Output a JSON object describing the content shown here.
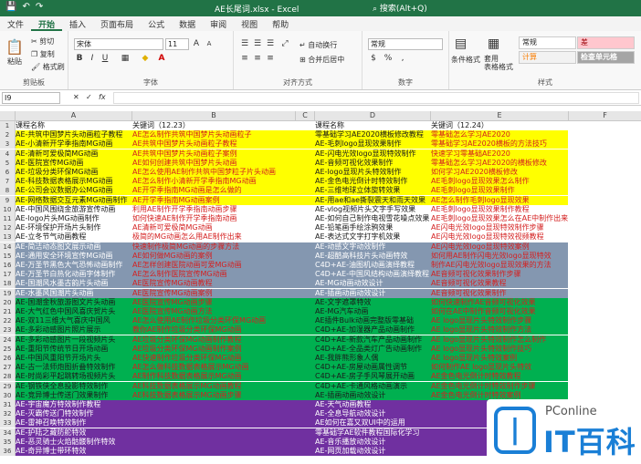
{
  "window": {
    "title": "AE长尾词.xlsx  -  Excel",
    "search": "搜索(Alt+Q)"
  },
  "tabs": [
    "文件",
    "开始",
    "插入",
    "页面布局",
    "公式",
    "数据",
    "审阅",
    "视图",
    "帮助"
  ],
  "ribbon": {
    "clipboard": {
      "label": "剪贴板",
      "paste": "粘贴",
      "cut": "剪切",
      "copy": "复制",
      "painter": "格式刷"
    },
    "font": {
      "label": "字体",
      "name": "宋体",
      "size": "11"
    },
    "align": {
      "label": "对齐方式",
      "wrap": "自动换行",
      "merge": "合并后居中"
    },
    "number": {
      "label": "数字",
      "format": "常规"
    },
    "styles": {
      "label": "样式",
      "cond": "条件格式",
      "table": "套用\n表格格式",
      "normal": "常规",
      "bad": "差",
      "calc": "计算",
      "check": "检查单元格"
    }
  },
  "formula": {
    "name": "I9",
    "fx": "fx"
  },
  "columns": [
    "A",
    "B",
    "C",
    "D",
    "E",
    "F"
  ],
  "colors": {
    "yellow": "#ffff00",
    "white": "#ffffff",
    "slate": "#8497b0",
    "green": "#00b050",
    "purple": "#7030a0",
    "excel": "#217346"
  },
  "rows": [
    {
      "n": "1",
      "bg": "white",
      "a": "课程名称",
      "b": "关键词（12.23）",
      "d": "课程名称",
      "e": "关键词（12.24）",
      "ac": "blk",
      "bc": "blk"
    },
    {
      "n": "2",
      "bg": "yellow",
      "a": "AE-共筑中国梦片头动画粒子教程",
      "b": "AE怎么制作共筑中国梦片头动画粒子",
      "d": "零基础学习AE2020横板修改教程",
      "e": "零基础怎么学习AE2020",
      "ac": "blk",
      "bc": "red"
    },
    {
      "n": "3",
      "bg": "yellow",
      "a": "AE-小清新开学季指南MG动画",
      "b": "AE共筑中国梦片头动画粒子教程",
      "d": "AE-毛刺logo显现效果制作",
      "e": "零基础学习AE2020横板的方法技巧",
      "ac": "blk",
      "bc": "red"
    },
    {
      "n": "4",
      "bg": "yellow",
      "a": "AE-清新可爱极简MG动画",
      "b": "AE共筑中国梦片头动画粒子案例",
      "d": "AE-闪电光效logo显现特效制作",
      "e": "快速学习零基础AE2020",
      "ac": "blk",
      "bc": "red"
    },
    {
      "n": "5",
      "bg": "yellow",
      "a": "AE-医院宣传MG动画",
      "b": "AE如何创建共筑中国梦片头动画",
      "d": "AE-音频可视化效果制作",
      "e": "零基础怎么学习AE2020的横板修改",
      "ac": "blk",
      "bc": "red"
    },
    {
      "n": "6",
      "bg": "yellow",
      "a": "AE-垃圾分类环保MG动画",
      "b": "AE怎么使用AE制作共筑中国梦粒子片头动画",
      "d": "AE-logo显现片头特效制作",
      "e": "如何学习AE2020横板修改",
      "ac": "blk",
      "bc": "red"
    },
    {
      "n": "7",
      "bg": "yellow",
      "a": "AE-科技数据表格展示MG动画",
      "b": "AE怎么制作小清新开学季指南MG动画",
      "d": "AE-金色电光倒计时特效制作",
      "e": "AE毛刺logo显现效果怎么制作",
      "ac": "blk",
      "bc": "red"
    },
    {
      "n": "8",
      "bg": "yellow",
      "a": "AE-公司会议数据办公MG动画",
      "b": "AE开学季指南MG动画是怎么做的",
      "d": "AE-三维地球立体旋转效果",
      "e": "AE毛刺logo显现效果制作",
      "ac": "blk",
      "bc": "red"
    },
    {
      "n": "9",
      "bg": "yellow",
      "a": "AE-网络数据交互元素MG动画制作",
      "b": "AE开学季指南MG动画案例",
      "d": "AE-用ae和ae撕裂震天和雨天效果",
      "e": "AE怎么制作毛刺logo显现效果",
      "ac": "blk",
      "bc": "red"
    },
    {
      "n": "10",
      "bg": "white",
      "a": "AE-中国风围绕金旅游宣传动画",
      "b": "利用AE制作开学季指南动画步骤",
      "d": "AE-vlog视频片头文字手写效果",
      "e": "AE毛刺logo显现效果制作教程",
      "ac": "blk",
      "bc": "red"
    },
    {
      "n": "11",
      "bg": "white",
      "a": "AE-logo片头MG动画制作",
      "b": "如何快速AE制作开学季指南动画",
      "d": "AE-如何自己制作电视雪花噪点效果",
      "e": "AE毛刺logo显现效果怎么在AE中制作出来",
      "ac": "blk",
      "bc": "red"
    },
    {
      "n": "12",
      "bg": "white",
      "a": "AE-环境保护开场片头制作",
      "b": "AE清新可爱极简MG动画",
      "d": "AE-铅笔画手绘涂鸦效果",
      "e": "AE闪电光效logo显现特效制作步骤",
      "ac": "blk",
      "bc": "red"
    },
    {
      "n": "13",
      "bg": "white",
      "a": "AE-立冬节气动画教程",
      "b": "极简的MG动画怎么用AE制作出来",
      "d": "AE-表达式文字打字机效果",
      "e": "AE闪电光效logo显现特效视频教程",
      "ac": "blk",
      "bc": "red"
    },
    {
      "n": "14",
      "bg": "slate",
      "a": "AE-简洁动态图文展示动画",
      "b": "快速制作极简MG动画的步骤方法",
      "d": "AE-动感文字动效制作",
      "e": "AE闪电光效logo显现特效案例",
      "ac": "blk",
      "bc": "red"
    },
    {
      "n": "15",
      "bg": "slate",
      "a": "AE-通用安全环境宣传MG动画",
      "b": "AE如何做MG动画的案例",
      "d": "AE-超酷高科技片头动画特效",
      "e": "如何用AE制作闪电光效logo显现特效",
      "ac": "blk",
      "bc": "red"
    },
    {
      "n": "16",
      "bg": "slate",
      "a": "AE-万圣节黑色大气恐怖动画制作",
      "b": "AE怎样创建医院动画可爱MG动画",
      "d": "C4D+AE-油图机动画演绎教程",
      "e": "制作AE闪电光效logo显现效果的方法",
      "ac": "blk",
      "bc": "red"
    },
    {
      "n": "17",
      "bg": "slate",
      "a": "AE-万圣节白热化动画字体制作",
      "b": "AE怎么制作医院宣传MG动画",
      "d": "C4D+AE-中国风结构动画演绎教程",
      "e": "AE音频可视化效果制作步骤",
      "ac": "blk",
      "bc": "red"
    },
    {
      "n": "18",
      "bg": "slate",
      "a": "AE-国潮风水墨古韵片头动画",
      "b": "AE医院宣传MG动画教程",
      "d": "AE-MG动画动效设计",
      "e": "AE音频可视化效果教程",
      "ac": "blk",
      "bc": "red"
    },
    {
      "n": "19",
      "bg": "slate",
      "a": "AE-水墨风国潮片头动画",
      "b": "AE医院宣传MG动画案例",
      "d": "AE-插画动画动效设计",
      "e": "AE音频可视化效果制作",
      "ac": "blk",
      "bc": "red"
    },
    {
      "n": "20",
      "bg": "green",
      "a": "AE-国潮金秋旅游图文片头动画",
      "b": "AE医院宣传MG动画步骤",
      "d": "AE-文字遮罩特效",
      "e": "如何快速制作AE音频可视化效果",
      "ac": "blk",
      "bc": "red"
    },
    {
      "n": "21",
      "bg": "green",
      "a": "AE-大气红色中国风喜庆贺片头",
      "b": "AE医院宣传MG动画方法",
      "d": "AE-MG汽车动画",
      "e": "如何在AE中制作音频可视化效果",
      "ac": "blk",
      "bc": "red"
    },
    {
      "n": "22",
      "bg": "green",
      "a": "AE-双11三维大气喜庆中国风",
      "b": "AE怎么使用AE制作垃圾分类环保MG动画",
      "d": "AE插件Bulk动画完整版零基础",
      "e": "AE logo显现片头特效制作步骤",
      "ac": "blk",
      "bc": "red"
    },
    {
      "n": "23",
      "bg": "green",
      "a": "AE-多彩动感图片照片展示",
      "b": "教你AE制作垃圾分类环保MG动画",
      "d": "C4D+AE-加湿器产品动画制作",
      "e": "AE logo显现片头特效制作方法",
      "ac": "blk",
      "bc": "red"
    },
    {
      "n": "24",
      "bg": "green",
      "a": "AE-多彩动感图片一段视频片头",
      "b": "AE垃圾分类环保MG动画制作教程",
      "d": "C4D+AE-新款汽车产品动画制作",
      "e": "AE logo显现片头特效制作怎么制作",
      "ac": "blk",
      "bc": "red"
    },
    {
      "n": "25",
      "bg": "green",
      "a": "AE-重阳节传统节日开场动画",
      "b": "AE垃圾分类环保MG动画制作案例",
      "d": "C4D+AE-全品类灯广告动画制作",
      "e": "AE logo显现片头特效制作技巧",
      "ac": "blk",
      "bc": "red"
    },
    {
      "n": "26",
      "bg": "green",
      "a": "AE-中国风重阳节开场片头",
      "b": "AE快速制作垃圾分类环保MG动画",
      "d": "AE-我胖熊形象人偶",
      "e": "AE logo显现片头特效案例",
      "ac": "blk",
      "bc": "red"
    },
    {
      "n": "27",
      "bg": "green",
      "a": "AE-古一法师炮图折叠特效制作",
      "b": "AE怎么做科技数据表格展示MG动画",
      "d": "C4D+AE-房屋动画属性调节",
      "e": "如何制作AE logo显现片头特效",
      "ac": "blk",
      "bc": "red"
    },
    {
      "n": "28",
      "bg": "green",
      "a": "AE-时尚彩平起跳转场视频片头",
      "b": "AE制作科技数据表格展示MG动画",
      "d": "C4D+AE-房子手风琴展开动画",
      "e": "AE金色电光倒计时特效教程",
      "ac": "blk",
      "bc": "red"
    },
    {
      "n": "29",
      "bg": "green",
      "a": "AE-钢铁侠全息投影特效制作",
      "b": "AE科技数据表格展示MG动画教程",
      "d": "C4D+AE-卡通风格动画演示",
      "e": "AE金色电光倒计时特效制作步骤",
      "ac": "blk",
      "bc": "red"
    },
    {
      "n": "30",
      "bg": "green",
      "a": "AE-竞异博士传送门效果制作",
      "b": "AE科技数据表格展示MG动画步骤",
      "d": "AE-插画动画动效设计",
      "e": "AE金色电光倒计时特效案例",
      "ac": "blk",
      "bc": "red"
    },
    {
      "n": "31",
      "bg": "purple",
      "a": "AE-宇宙魔方特效制作教程",
      "b": "",
      "d": "AE-天气动画教程",
      "e": "",
      "ac": "blk",
      "bc": "red"
    },
    {
      "n": "32",
      "bg": "purple",
      "a": "AE-灭霸传送门特效制作",
      "b": "",
      "d": "AE-全息导航动效设计",
      "e": "",
      "ac": "blk",
      "bc": "red"
    },
    {
      "n": "33",
      "bg": "purple",
      "a": "AE-雷神召唤特效制作",
      "b": "",
      "d": "AE如何在嘉又双UI中的运用",
      "e": "",
      "ac": "blk",
      "bc": "red"
    },
    {
      "n": "34",
      "bg": "purple",
      "a": "AE-护陆之藏防舵特效",
      "b": "",
      "d": "零基础学AE软件教程国际化学习",
      "e": "",
      "ac": "blk",
      "bc": "red"
    },
    {
      "n": "35",
      "bg": "purple",
      "a": "AE-恶灵骑士火焰骷髅制作特效",
      "b": "",
      "d": "AE-音乐播放动效设计",
      "e": "",
      "ac": "blk",
      "bc": "red"
    },
    {
      "n": "36",
      "bg": "purple",
      "a": "AE-奇异博士带环特效",
      "b": "",
      "d": "AE-网页加载动效设计",
      "e": "",
      "ac": "blk",
      "bc": "red"
    }
  ],
  "watermark": {
    "brand": "PConline",
    "big": "IT百科"
  }
}
